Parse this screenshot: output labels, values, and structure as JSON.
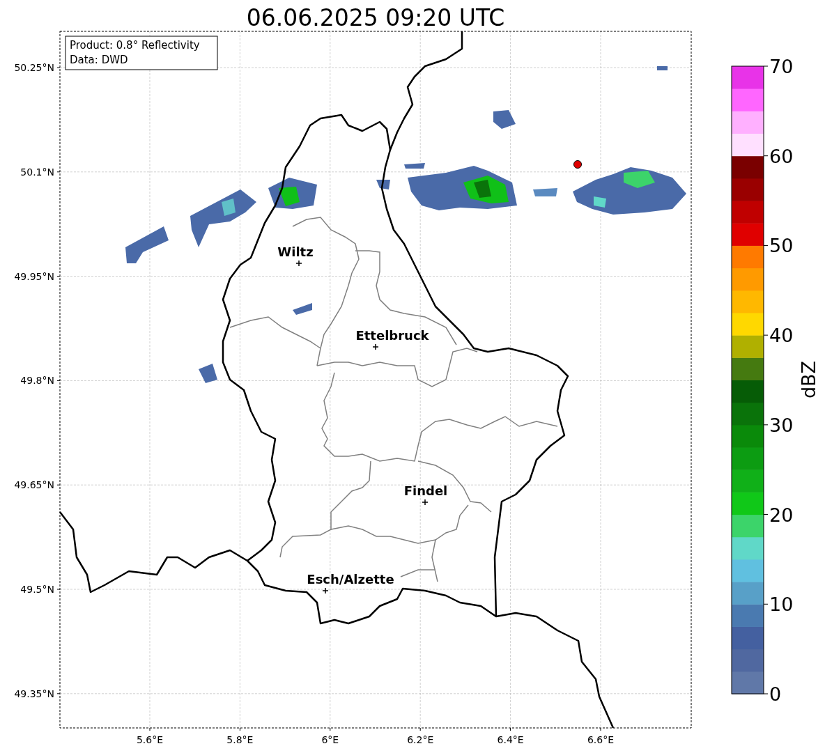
{
  "title": "06.06.2025 09:20 UTC",
  "info_box": [
    "Product: 0.8° Reflectivity",
    "Data: DWD"
  ],
  "y_ticks": [
    "50.25°N",
    "50.1°N",
    "49.95°N",
    "49.8°N",
    "49.65°N",
    "49.5°N",
    "49.35°N"
  ],
  "x_ticks": [
    "5.6°E",
    "5.8°E",
    "6°E",
    "6.2°E",
    "6.4°E",
    "6.6°E"
  ],
  "cities": [
    {
      "name": "Wiltz"
    },
    {
      "name": "Ettelbruck"
    },
    {
      "name": "Findel"
    },
    {
      "name": "Esch/Alzette"
    }
  ],
  "colorbar": {
    "label": "dBZ",
    "ticks": [
      "70",
      "60",
      "50",
      "40",
      "30",
      "20",
      "10",
      "0"
    ],
    "colors": [
      {
        "color": "#6078a8"
      },
      {
        "color": "#5068a0"
      },
      {
        "color": "#4460a0"
      },
      {
        "color": "#4a7ab0"
      },
      {
        "color": "#58a0c8"
      },
      {
        "color": "#60c0e0"
      },
      {
        "color": "#60d8c8"
      },
      {
        "color": "#3cd46a"
      },
      {
        "color": "#10c818"
      },
      {
        "color": "#10b018"
      },
      {
        "color": "#0c9c12"
      },
      {
        "color": "#0a8a0a"
      },
      {
        "color": "#0a730a"
      },
      {
        "color": "#065c06"
      },
      {
        "color": "#457a10"
      },
      {
        "color": "#b0b000"
      },
      {
        "color": "#ffd800"
      },
      {
        "color": "#ffb800"
      },
      {
        "color": "#ff9a00"
      },
      {
        "color": "#ff7a00"
      },
      {
        "color": "#e00000"
      },
      {
        "color": "#c00000"
      },
      {
        "color": "#9a0000"
      },
      {
        "color": "#7a0000"
      },
      {
        "color": "#ffe0ff"
      },
      {
        "color": "#ffb0ff"
      },
      {
        "color": "#ff66ff"
      },
      {
        "color": "#e833e8"
      }
    ]
  }
}
